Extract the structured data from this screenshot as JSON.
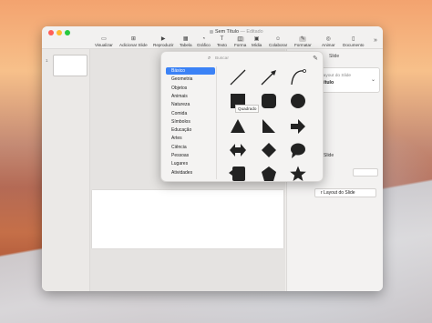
{
  "window": {
    "title": "Sem Título",
    "title_suffix": "— Editado"
  },
  "toolbar": {
    "items": [
      {
        "label": "Visualizar",
        "icon": "sidebar-icon"
      },
      {
        "label": "Adicionar Slide",
        "icon": "plus-icon"
      },
      {
        "label": "Reproduzir",
        "icon": "play-icon"
      },
      {
        "label": "Tabela",
        "icon": "table-icon"
      },
      {
        "label": "Gráfico",
        "icon": "chart-icon"
      },
      {
        "label": "Texto",
        "icon": "text-icon"
      },
      {
        "label": "Forma",
        "icon": "shape-icon"
      },
      {
        "label": "Mídia",
        "icon": "media-icon"
      },
      {
        "label": "Colaborar",
        "icon": "collaborate-icon"
      },
      {
        "label": "Formatar",
        "icon": "brush-icon"
      },
      {
        "label": "Animar",
        "icon": "animate-icon"
      },
      {
        "label": "Documento",
        "icon": "document-icon"
      }
    ],
    "overflow": "»"
  },
  "slides_panel": {
    "slide_number": "1"
  },
  "inspector": {
    "tabs": [
      "Slide"
    ],
    "layout_label": "Layout do Slide",
    "layout_value": "Título",
    "section_label": "Slide",
    "edit_button": "r Layout do Slide"
  },
  "shape_popover": {
    "search_placeholder": "Buscar",
    "categories": [
      "Básico",
      "Geometria",
      "Objetos",
      "Animais",
      "Natureza",
      "Comida",
      "Símbolos",
      "Educação",
      "Artes",
      "Ciência",
      "Pessoas",
      "Lugares",
      "Atividades"
    ],
    "selected_category": "Básico",
    "tooltip": "Quadrado",
    "shapes": [
      "line",
      "arrow-line",
      "curve",
      "square",
      "rounded-square",
      "circle",
      "triangle",
      "right-triangle",
      "arrow",
      "double-arrow",
      "diamond",
      "speech-bubble",
      "callout-square",
      "pentagon",
      "star"
    ],
    "selection_color": "#3b82f6"
  }
}
